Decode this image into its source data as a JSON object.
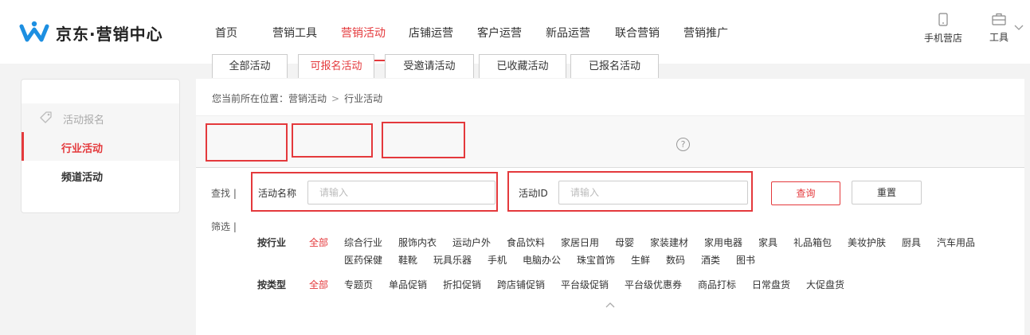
{
  "header": {
    "logo_text": "京东·营销中心",
    "nav": [
      {
        "label": "首页",
        "active": false
      },
      {
        "label": "营销工具",
        "active": false
      },
      {
        "label": "营销活动",
        "active": true
      },
      {
        "label": "店铺运营",
        "active": false
      },
      {
        "label": "客户运营",
        "active": false
      },
      {
        "label": "新品运营",
        "active": false
      },
      {
        "label": "联合营销",
        "active": false
      },
      {
        "label": "营销推广",
        "active": false
      }
    ],
    "tools": [
      {
        "label": "手机营店",
        "icon": "mobile-icon"
      },
      {
        "label": "工具",
        "icon": "toolbox-icon"
      }
    ]
  },
  "sidebar": {
    "group_label": "活动报名",
    "group_icon": "tag-icon",
    "items": [
      {
        "label": "行业活动",
        "active": true
      },
      {
        "label": "频道活动",
        "active": false
      }
    ]
  },
  "breadcrumb": {
    "prefix": "您当前所在位置：",
    "parent": "营销活动",
    "separator": ">",
    "current": "行业活动"
  },
  "tabs": [
    {
      "label": "全部活动",
      "active": false
    },
    {
      "label": "可报名活动",
      "active": true
    },
    {
      "label": "受邀请活动",
      "active": false
    },
    {
      "label": "已收藏活动",
      "active": false
    },
    {
      "label": "已报名活动",
      "active": false
    }
  ],
  "search": {
    "row_label": "查找 |",
    "name_label": "活动名称",
    "name_placeholder": "请输入",
    "id_label": "活动ID",
    "id_placeholder": "请输入",
    "query_label": "查询",
    "reset_label": "重置"
  },
  "filter": {
    "row_label": "筛选 |",
    "industry": {
      "label": "按行业",
      "options": [
        "全部",
        "综合行业",
        "服饰内衣",
        "运动户外",
        "食品饮料",
        "家居日用",
        "母婴",
        "家装建材",
        "家用电器",
        "家具",
        "礼品箱包",
        "美妆护肤",
        "厨具",
        "汽车用品",
        "医药保健",
        "鞋靴",
        "玩具乐器",
        "手机",
        "电脑办公",
        "珠宝首饰",
        "生鲜",
        "数码",
        "酒类",
        "图书"
      ],
      "selected": "全部"
    },
    "type": {
      "label": "按类型",
      "options": [
        "全部",
        "专题页",
        "单品促销",
        "折扣促销",
        "跨店铺促销",
        "平台级促销",
        "平台级优惠券",
        "商品打标",
        "日常盘货",
        "大促盘货"
      ],
      "selected": "全部"
    }
  },
  "colors": {
    "accent": "#e4393c",
    "logo_blue": "#1d8fe1",
    "highlight": "#e4393c"
  }
}
